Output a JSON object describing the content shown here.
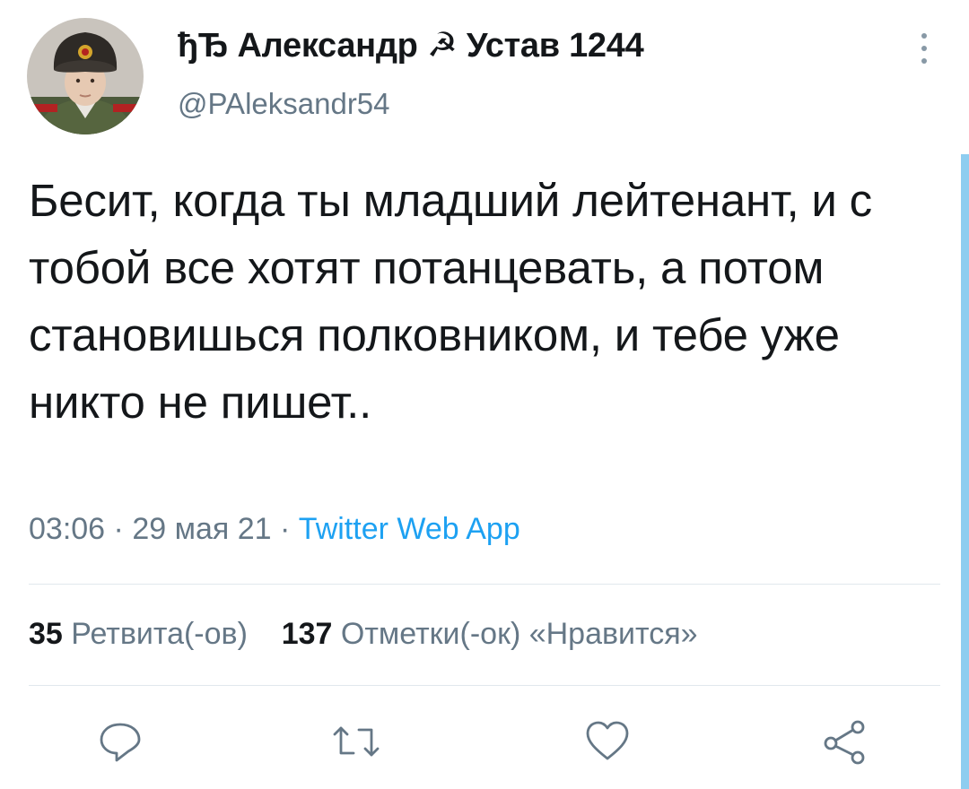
{
  "author": {
    "name": "ђЂ Александр ☭ Устав 1244",
    "handle": "@PAleksandr54"
  },
  "tweet": {
    "text": "Бесит, когда ты младший лейтенант, и с тобой все хотят потанцевать, а потом становишься полковником, и тебе уже никто не пишет..",
    "time": "03:06",
    "date": "29 мая 21",
    "separator": "·",
    "source": "Twitter Web App"
  },
  "stats": {
    "retweets_count": "35",
    "retweets_label": "Ретвита(-ов)",
    "likes_count": "137",
    "likes_label": "Отметки(-ок) «Нравится»"
  },
  "colors": {
    "accent": "#1da1f2",
    "secondary_text": "#657786",
    "divider": "#e1e8ed",
    "scroll_accent": "#8ecdf0"
  }
}
